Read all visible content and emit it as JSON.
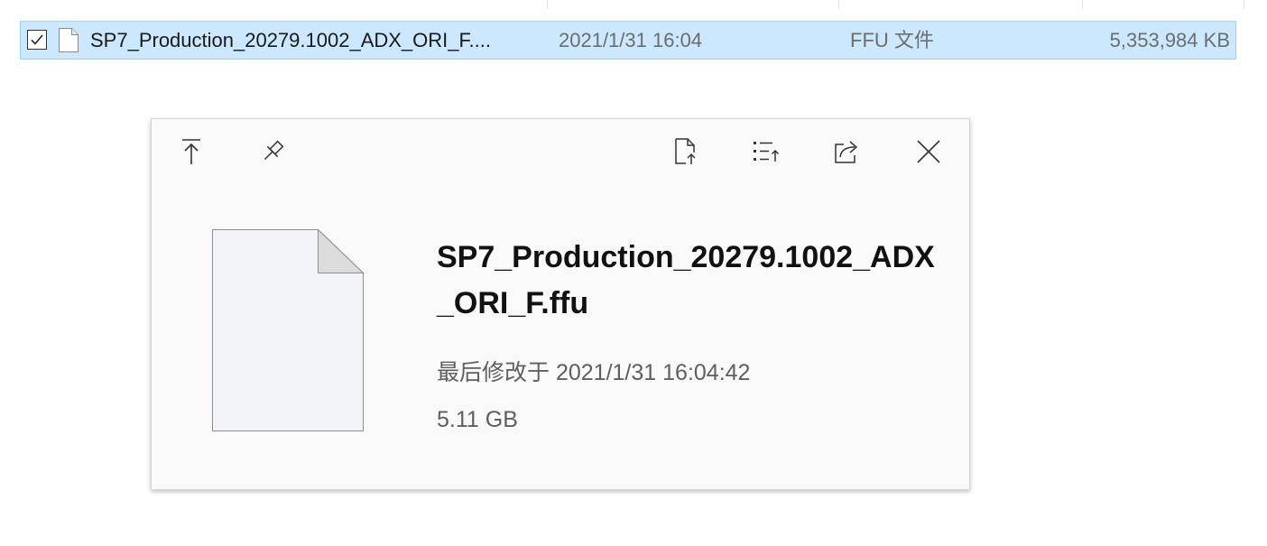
{
  "file_row": {
    "checked": true,
    "name": "SP7_Production_20279.1002_ADX_ORI_F....",
    "date": "2021/1/31 16:04",
    "type": "FFU 文件",
    "size": "5,353,984 KB",
    "selection_color": "#cce8ff"
  },
  "preview": {
    "toolbar": {
      "icons": [
        "open-file-location-icon",
        "pin-icon",
        "open-file-icon",
        "details-icon",
        "share-icon",
        "close-icon"
      ]
    },
    "file_name": "SP7_Production_20279.1002_ADX_ORI_F.ffu",
    "modified_label": "最后修改于",
    "modified_value": "2021/1/31 16:04:42",
    "size": "5.11 GB"
  }
}
